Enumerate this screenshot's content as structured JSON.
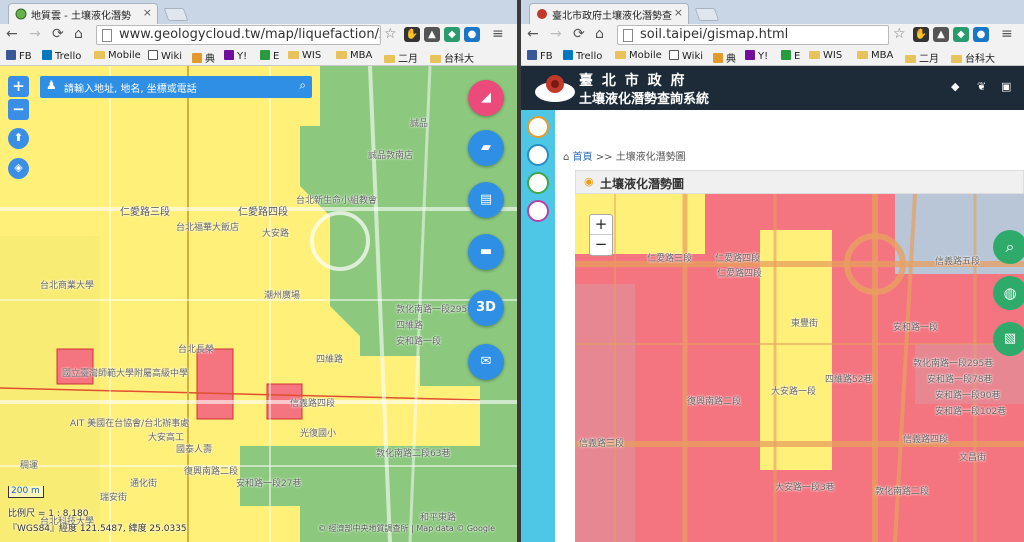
{
  "left": {
    "tab_title": "地質雲 - 土壤液化潛勢",
    "url": "www.geologycloud.tw/map/liquefaction/zh-t",
    "search_placeholder": "請輸入地址, 地名, 坐標或電話",
    "fab_3d": "3D",
    "scale_label": "200 m",
    "scale_ratio": "比例尺 = 1 : 8,180",
    "coords": "『WGS84』經度 121.5487, 緯度 25.0335",
    "attribution": "© 經濟部中央地質調查所 | Map data © Google",
    "map_labels": [
      "仁愛路三段",
      "仁愛路四段",
      "台北福華大飯店",
      "台北新生命小組教會",
      "誠品敦南店",
      "國立臺灣師範大學附屬高級中學",
      "AIT 美國在台協會/台北辦事處",
      "大安路",
      "台北長榮",
      "敦化南路一段295巷",
      "四維路",
      "安和路一段",
      "敦化南路二段63巷",
      "大安高工",
      "信義路四段",
      "復興南路二段",
      "瑞安街",
      "國泰人壽",
      "安和路一段27巷",
      "光復國小",
      "四維路",
      "潮州廣場",
      "台北商業大學",
      "稠運",
      "通化街",
      "和平東路",
      "台北科技大學",
      "誠品"
    ]
  },
  "right": {
    "tab_title": "臺北市政府土壤液化潛勢查",
    "url": "soil.taipei/gismap.html",
    "header_line1": "臺 北 市 政 府",
    "header_line2": "土壤液化潛勢查詢系統",
    "breadcrumb_home": "首頁",
    "breadcrumb_sep": ">>",
    "breadcrumb_current": "土壤液化潛勢圖",
    "panel_title": "土壤液化潛勢圖",
    "zoom_in": "+",
    "zoom_out": "−",
    "map_labels": [
      "仁愛路三段",
      "仁愛路四段",
      "東豐街",
      "敦化南路一段295巷",
      "安和路一段78巷",
      "安和路一段90巷",
      "安和路一段102巷",
      "信義路四段",
      "文昌街",
      "四維路52巷",
      "大安路一段",
      "復興南路二段",
      "信義路三段",
      "仁愛路四段",
      "安和路一段",
      "敦化南路二段",
      "大安路一段3巷",
      "信義路五段"
    ]
  },
  "bookmarks": [
    "FB",
    "Trello",
    "Mobile",
    "Wiki",
    "典",
    "Y!",
    "E",
    "WIS",
    "MBA",
    "二月",
    "台科大"
  ],
  "colors": {
    "liq_high": "#f4757f",
    "liq_mid": "#fff07a",
    "liq_low": "#8cc97e",
    "accent": "#2f8fe4",
    "header": "#1d2b38",
    "sidebar": "#4ec6e6"
  }
}
